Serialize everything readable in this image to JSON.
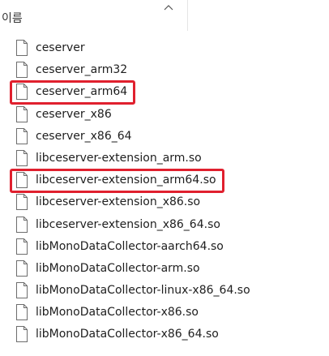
{
  "header": {
    "name_column_label": "이름",
    "sort_icon": "chevron-up-icon"
  },
  "files": [
    {
      "name": "ceserver",
      "icon": "file-icon"
    },
    {
      "name": "ceserver_arm32",
      "icon": "file-icon"
    },
    {
      "name": "ceserver_arm64",
      "icon": "file-icon",
      "highlighted": true
    },
    {
      "name": "ceserver_x86",
      "icon": "file-icon"
    },
    {
      "name": "ceserver_x86_64",
      "icon": "file-icon"
    },
    {
      "name": "libceserver-extension_arm.so",
      "icon": "file-icon"
    },
    {
      "name": "libceserver-extension_arm64.so",
      "icon": "file-icon",
      "highlighted": true
    },
    {
      "name": "libceserver-extension_x86.so",
      "icon": "file-icon"
    },
    {
      "name": "libceserver-extension_x86_64.so",
      "icon": "file-icon"
    },
    {
      "name": "libMonoDataCollector-aarch64.so",
      "icon": "file-icon"
    },
    {
      "name": "libMonoDataCollector-arm.so",
      "icon": "file-icon"
    },
    {
      "name": "libMonoDataCollector-linux-x86_64.so",
      "icon": "file-icon"
    },
    {
      "name": "libMonoDataCollector-x86.so",
      "icon": "file-icon"
    },
    {
      "name": "libMonoDataCollector-x86_64.so",
      "icon": "file-icon"
    }
  ],
  "colors": {
    "highlight_border": "#e0202e",
    "text": "#1e1e1e"
  }
}
